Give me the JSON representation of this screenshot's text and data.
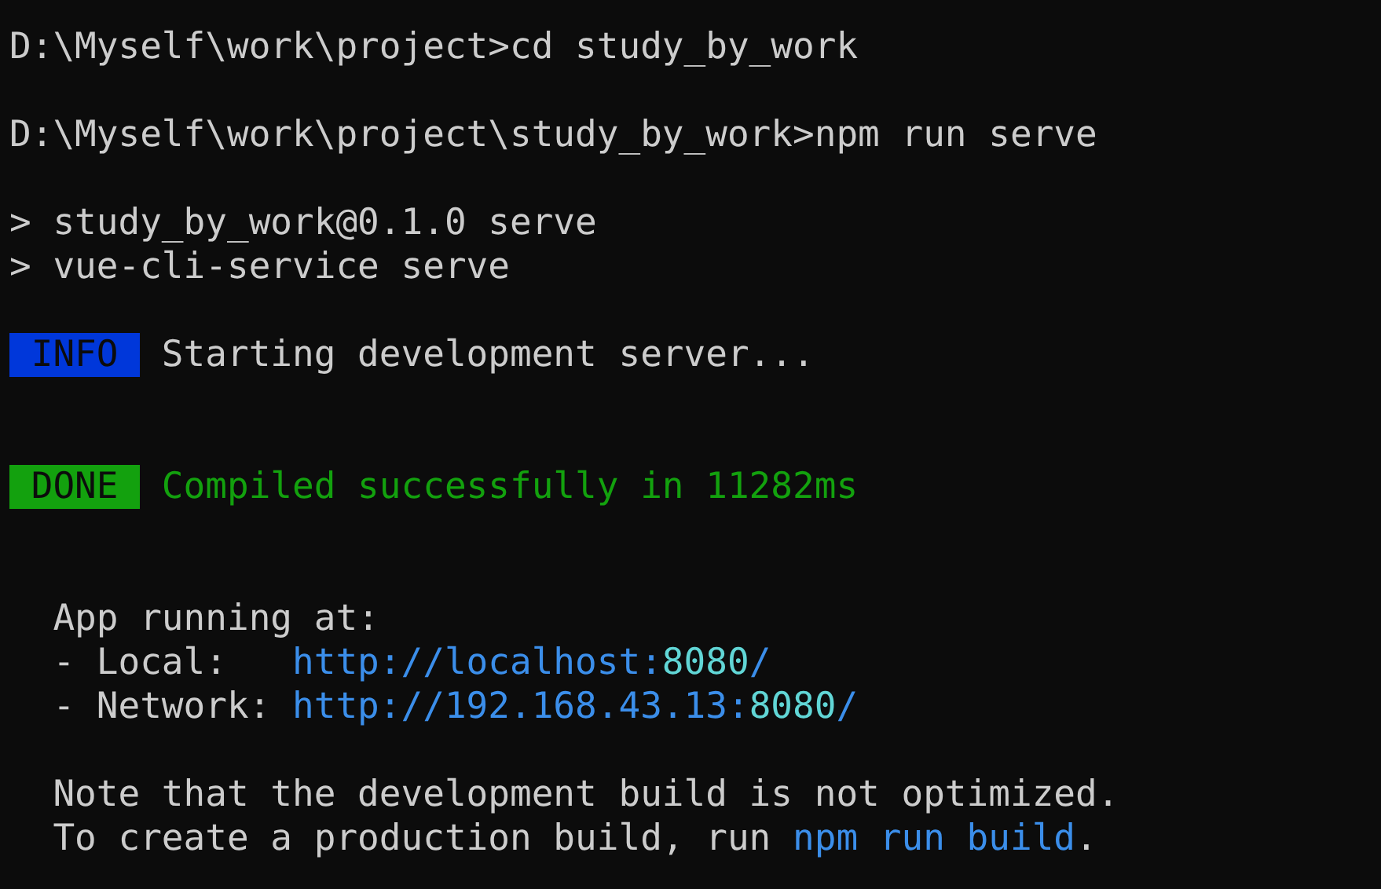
{
  "terminal": {
    "lines": [
      {
        "kind": "text",
        "segments": [
          {
            "kind": "plain",
            "text": "D:\\Myself\\work\\project>cd study_by_work"
          }
        ]
      },
      {
        "kind": "blank"
      },
      {
        "kind": "text",
        "segments": [
          {
            "kind": "plain",
            "text": "D:\\Myself\\work\\project\\study_by_work>npm run serve"
          }
        ]
      },
      {
        "kind": "blank"
      },
      {
        "kind": "text",
        "segments": [
          {
            "kind": "plain",
            "text": "> study_by_work@0.1.0 serve"
          }
        ]
      },
      {
        "kind": "text",
        "segments": [
          {
            "kind": "plain",
            "text": "> vue-cli-service serve"
          }
        ]
      },
      {
        "kind": "blank"
      },
      {
        "kind": "text",
        "segments": [
          {
            "kind": "badge",
            "text": "INFO",
            "color": "#0037da"
          },
          {
            "kind": "plain",
            "text": " Starting development server..."
          }
        ]
      },
      {
        "kind": "blank"
      },
      {
        "kind": "blank"
      },
      {
        "kind": "text",
        "segments": [
          {
            "kind": "badge",
            "text": "DONE",
            "color": "#13a10e"
          },
          {
            "kind": "success",
            "text": " Compiled successfully in 11282ms"
          }
        ]
      },
      {
        "kind": "blank"
      },
      {
        "kind": "blank"
      },
      {
        "kind": "text",
        "segments": [
          {
            "kind": "plain",
            "text": "  App running at:"
          }
        ]
      },
      {
        "kind": "text",
        "segments": [
          {
            "kind": "plain",
            "text": "  - Local:   "
          },
          {
            "kind": "url",
            "text": "http://localhost:",
            "port": "8080",
            "tail": "/"
          }
        ]
      },
      {
        "kind": "text",
        "segments": [
          {
            "kind": "plain",
            "text": "  - Network: "
          },
          {
            "kind": "url",
            "text": "http://192.168.43.13:",
            "port": "8080",
            "tail": "/"
          }
        ]
      },
      {
        "kind": "blank"
      },
      {
        "kind": "text",
        "segments": [
          {
            "kind": "plain",
            "text": "  Note that the development build is not optimized."
          }
        ]
      },
      {
        "kind": "text",
        "segments": [
          {
            "kind": "plain",
            "text": "  To create a production build, run "
          },
          {
            "kind": "command",
            "text": "npm run build"
          },
          {
            "kind": "plain",
            "text": "."
          }
        ]
      }
    ]
  }
}
